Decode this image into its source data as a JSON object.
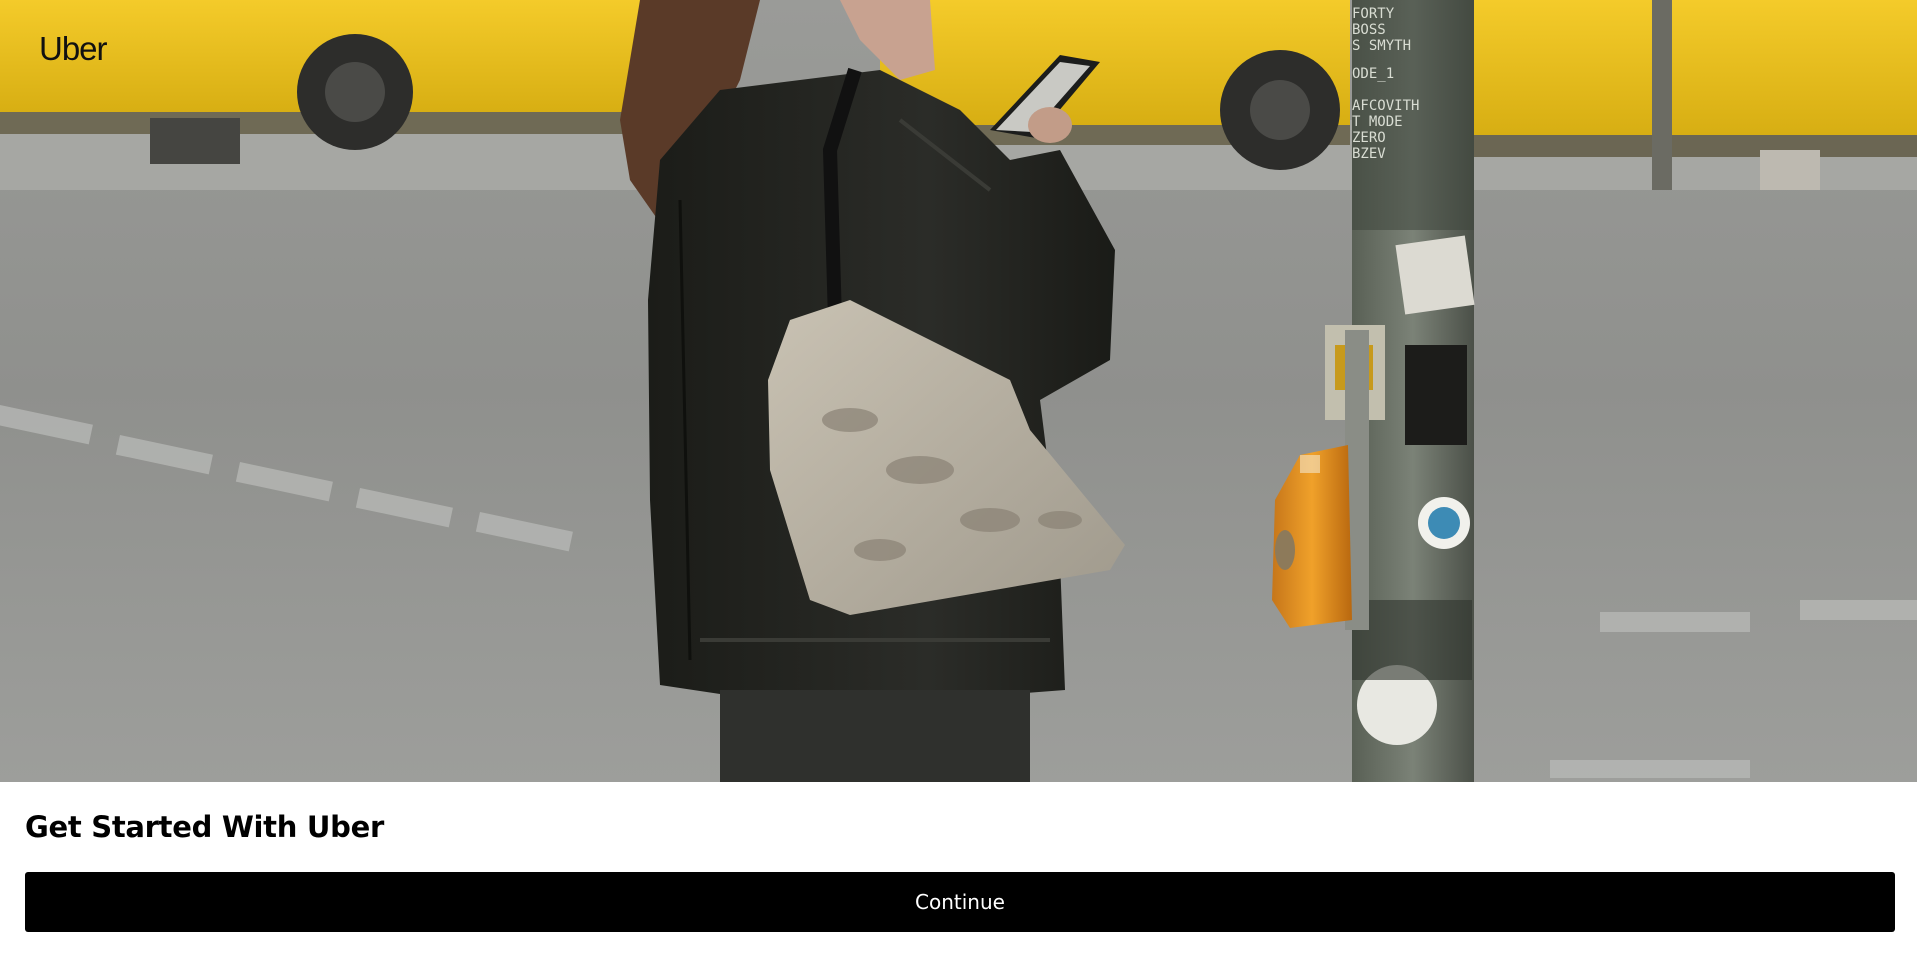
{
  "brand": {
    "logo_text": "Uber"
  },
  "hero": {
    "image_description_icon": "street-photo",
    "pole_sticker_lines": [
      "FORTY",
      "BOSS",
      "S SMYTH",
      "ODE_1",
      "AFCOVITH",
      "T MODE",
      "ZERO",
      "BZEV"
    ]
  },
  "main": {
    "headline": "Get Started With Uber",
    "continue_label": "Continue"
  },
  "colors": {
    "bus_yellow": "#f2c418",
    "button_bg": "#000000",
    "button_text": "#ffffff",
    "meter_orange": "#e8951f"
  }
}
